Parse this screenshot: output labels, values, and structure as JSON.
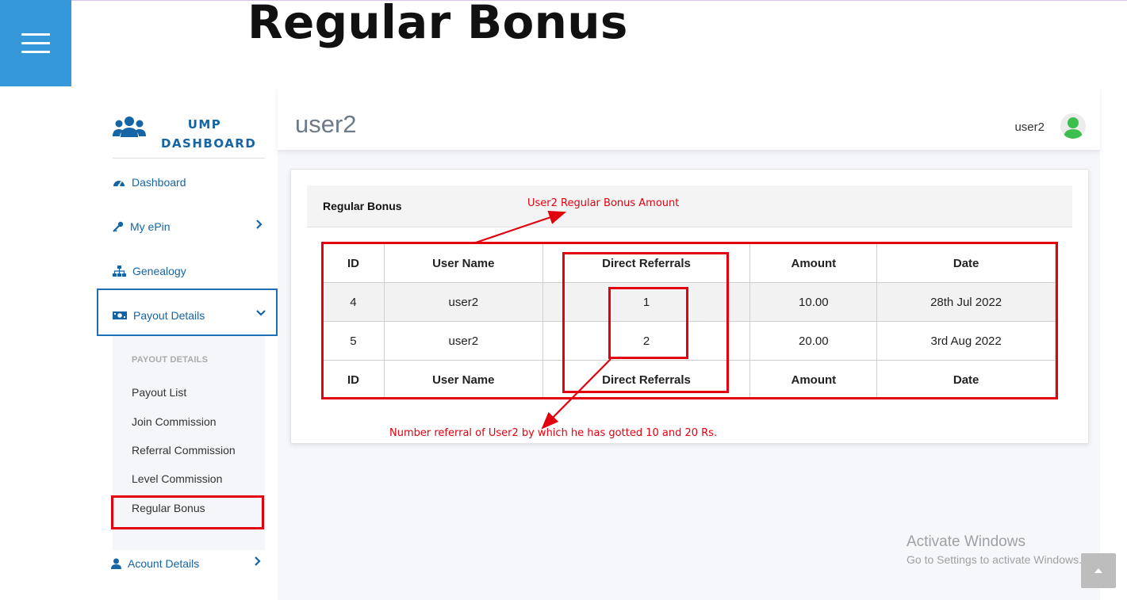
{
  "page": {
    "heading": "Regular Bonus"
  },
  "sidebar": {
    "brand": {
      "line1": "UMP",
      "line2": "DASHBOARD"
    },
    "items": [
      {
        "label": "Dashboard",
        "icon": "gauge-icon"
      },
      {
        "label": "My ePin",
        "icon": "key-icon"
      },
      {
        "label": "Genealogy",
        "icon": "sitemap-icon"
      },
      {
        "label": "Payout Details",
        "icon": "money-icon"
      },
      {
        "label": "Acount Details",
        "icon": "user-icon"
      }
    ],
    "submenu": {
      "title": "PAYOUT DETAILS",
      "items": [
        "Payout List",
        "Join Commission",
        "Referral Commission",
        "Level Commission",
        "Regular Bonus"
      ]
    }
  },
  "header": {
    "title": "user2",
    "username": "user2"
  },
  "card": {
    "title": "Regular Bonus"
  },
  "table": {
    "columns": [
      "ID",
      "User Name",
      "Direct Referrals",
      "Amount",
      "Date"
    ],
    "rows": [
      [
        "4",
        "user2",
        "1",
        "10.00",
        "28th Jul 2022"
      ],
      [
        "5",
        "user2",
        "2",
        "20.00",
        "3rd Aug 2022"
      ]
    ]
  },
  "annotations": {
    "amount_note": "User2 Regular Bonus Amount",
    "referral_note": "Number referral of User2 by which he has gotted 10 and 20 Rs."
  },
  "watermark": {
    "line1": "Activate Windows",
    "line2": "Go to Settings to activate Windows."
  },
  "colors": {
    "accent_blue": "#3498db",
    "nav_blue": "#1565a6",
    "annotation_red": "#e3000f",
    "avatar_green": "#3cbf4e"
  }
}
